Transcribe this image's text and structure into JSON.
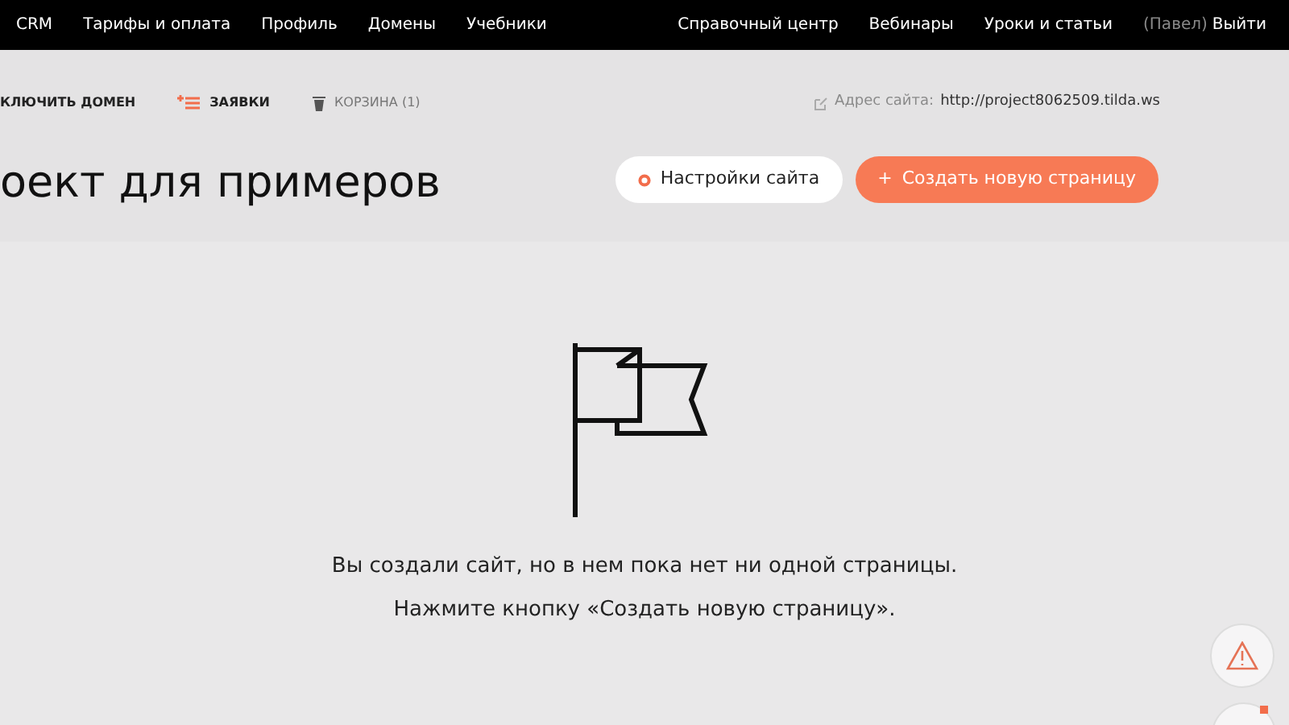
{
  "top_nav": {
    "left": [
      "CRM",
      "Тарифы и оплата",
      "Профиль",
      "Домены",
      "Учебники"
    ],
    "right": [
      "Справочный центр",
      "Вебинары",
      "Уроки и статьи"
    ],
    "user": "(Павел)",
    "logout": "Выйти"
  },
  "toolbar": {
    "domain": "КЛЮЧИТЬ ДОМЕН",
    "requests": "ЗАЯВКИ",
    "trash": "КОРЗИНА (1)",
    "address_label": "Адрес сайта:",
    "address": "http://project8062509.tilda.ws"
  },
  "project_title": "оект для примеров",
  "buttons": {
    "settings": "Настройки сайта",
    "create": "Создать новую страницу",
    "create_icon": "+"
  },
  "empty": {
    "line_1": "Вы создали сайт, но в нем пока нет ни одной страницы.",
    "line_2": "Нажмите кнопку «Создать новую страницу»."
  }
}
